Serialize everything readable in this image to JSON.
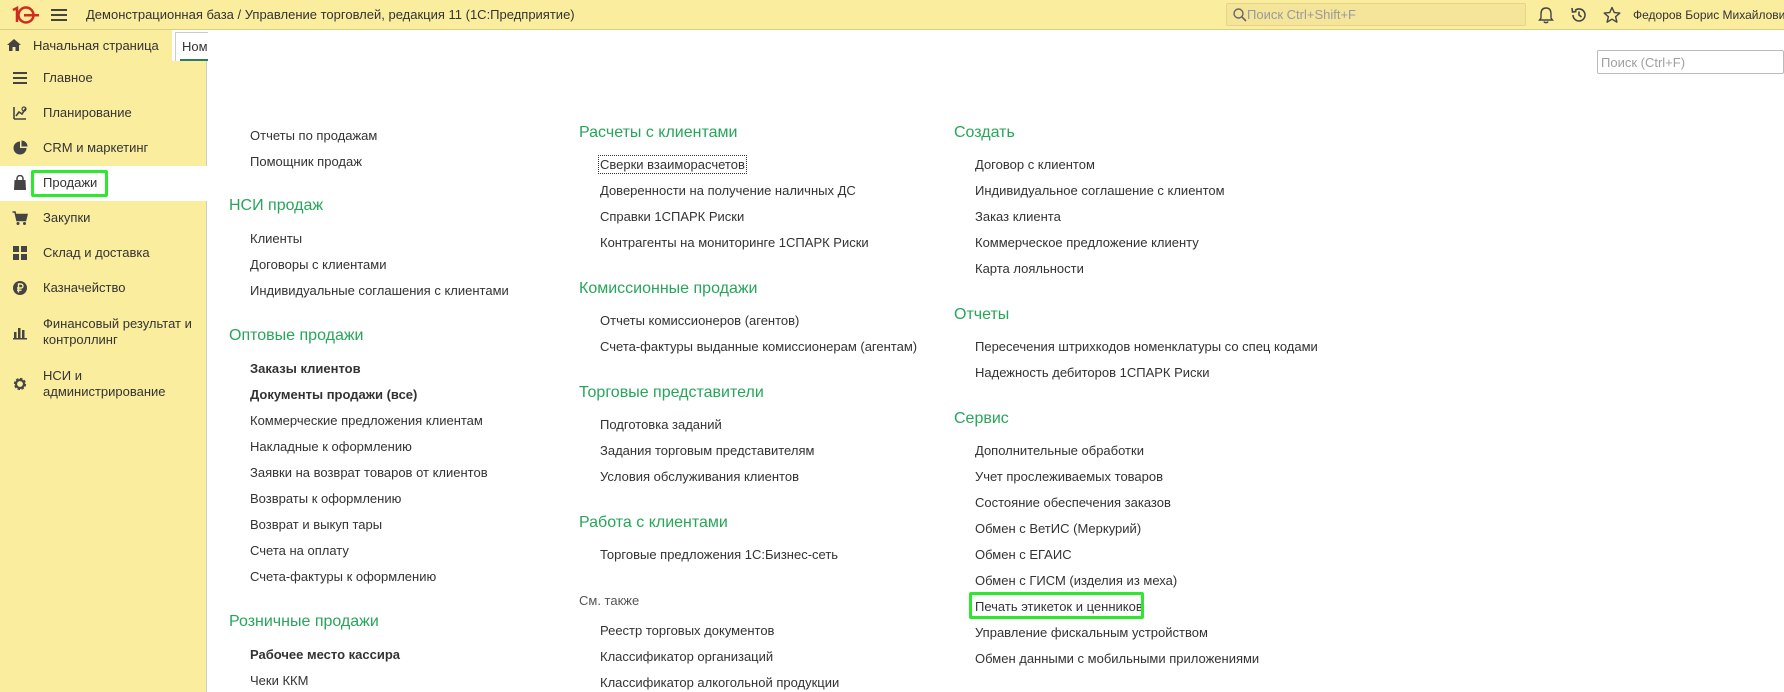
{
  "app": {
    "title": "Демонстрационная база / Управление торговлей, редакция 11  (1С:Предприятие)",
    "search_placeholder": "Поиск Ctrl+Shift+F",
    "user": "Федоров Борис Михайлович",
    "logo_text": "1С"
  },
  "tabs": {
    "home": "Начальная страница",
    "current": "Номенклатура"
  },
  "sidebar": {
    "items": [
      {
        "label": "Главное",
        "icon": "hamburger-icon"
      },
      {
        "label": "Планирование",
        "icon": "planning-icon"
      },
      {
        "label": "CRM и маркетинг",
        "icon": "pie-chart-icon"
      },
      {
        "label": "Продажи",
        "icon": "shopping-bag-icon"
      },
      {
        "label": "Закупки",
        "icon": "cart-icon"
      },
      {
        "label": "Склад и доставка",
        "icon": "warehouse-icon"
      },
      {
        "label": "Казначейство",
        "icon": "ruble-coin-icon"
      },
      {
        "label": "Финансовый результат и",
        "label2": "контроллинг",
        "icon": "bar-chart-icon"
      },
      {
        "label": "НСИ и",
        "label2": "администрирование",
        "icon": "gear-icon"
      }
    ]
  },
  "main": {
    "search_placeholder": "Поиск (Ctrl+F)",
    "col1": {
      "top_links": [
        "Отчеты по продажам",
        "Помощник продаж"
      ],
      "nsi_title": "НСИ продаж",
      "nsi_links": [
        "Клиенты",
        "Договоры с клиентами",
        "Индивидуальные соглашения с клиентами"
      ],
      "wholesale_title": "Оптовые продажи",
      "wholesale_links": [
        "Заказы клиентов",
        "Документы продажи (все)",
        "Коммерческие предложения клиентам",
        "Накладные к оформлению",
        "Заявки на возврат товаров от клиентов",
        "Возвраты к оформлению",
        "Возврат и выкуп тары",
        "Счета на оплату",
        "Счета-фактуры к оформлению"
      ],
      "retail_title": "Розничные продажи",
      "retail_links": [
        "Рабочее место кассира",
        "Чеки ККМ"
      ]
    },
    "col2": {
      "settlements_title": "Расчеты с клиентами",
      "settlements_links": [
        "Сверки взаиморасчетов",
        "Доверенности на получение наличных ДС",
        "Справки 1СПАРК Риски",
        "Контрагенты на мониторинге 1СПАРК Риски"
      ],
      "commission_title": "Комиссионные продажи",
      "commission_links": [
        "Отчеты комиссионеров (агентов)",
        "Счета-фактуры выданные комиссионерам (агентам)"
      ],
      "reps_title": "Торговые представители",
      "reps_links": [
        "Подготовка заданий",
        "Задания торговым представителям",
        "Условия обслуживания клиентов"
      ],
      "clients_title": "Работа с клиентами",
      "clients_links": [
        "Торговые предложения 1С:Бизнес-сеть"
      ],
      "see_also_title": "См. также",
      "see_also_links": [
        "Реестр торговых документов",
        "Классификатор организаций",
        "Классификатор алкогольной продукции"
      ]
    },
    "col3": {
      "create_title": "Создать",
      "create_links": [
        "Договор с клиентом",
        "Индивидуальное соглашение с клиентом",
        "Заказ клиента",
        "Коммерческое предложение клиенту",
        "Карта лояльности"
      ],
      "reports_title": "Отчеты",
      "reports_links": [
        "Пересечения штрихкодов номенклатуры со спец кодами",
        "Надежность дебиторов 1СПАРК Риски"
      ],
      "service_title": "Сервис",
      "service_links": [
        "Дополнительные обработки",
        "Учет прослеживаемых товаров",
        "Состояние обеспечения заказов",
        "Обмен с ВетИС (Меркурий)",
        "Обмен с ЕГАИС",
        "Обмен с ГИСМ (изделия из меха)",
        "Печать этикеток и ценников",
        "Управление фискальным устройством",
        "Обмен данными с мобильными приложениями"
      ]
    }
  },
  "colors": {
    "accent_yellow": "#fbed9e",
    "group_green": "#27a65a",
    "highlight_green": "#2ee82e"
  }
}
